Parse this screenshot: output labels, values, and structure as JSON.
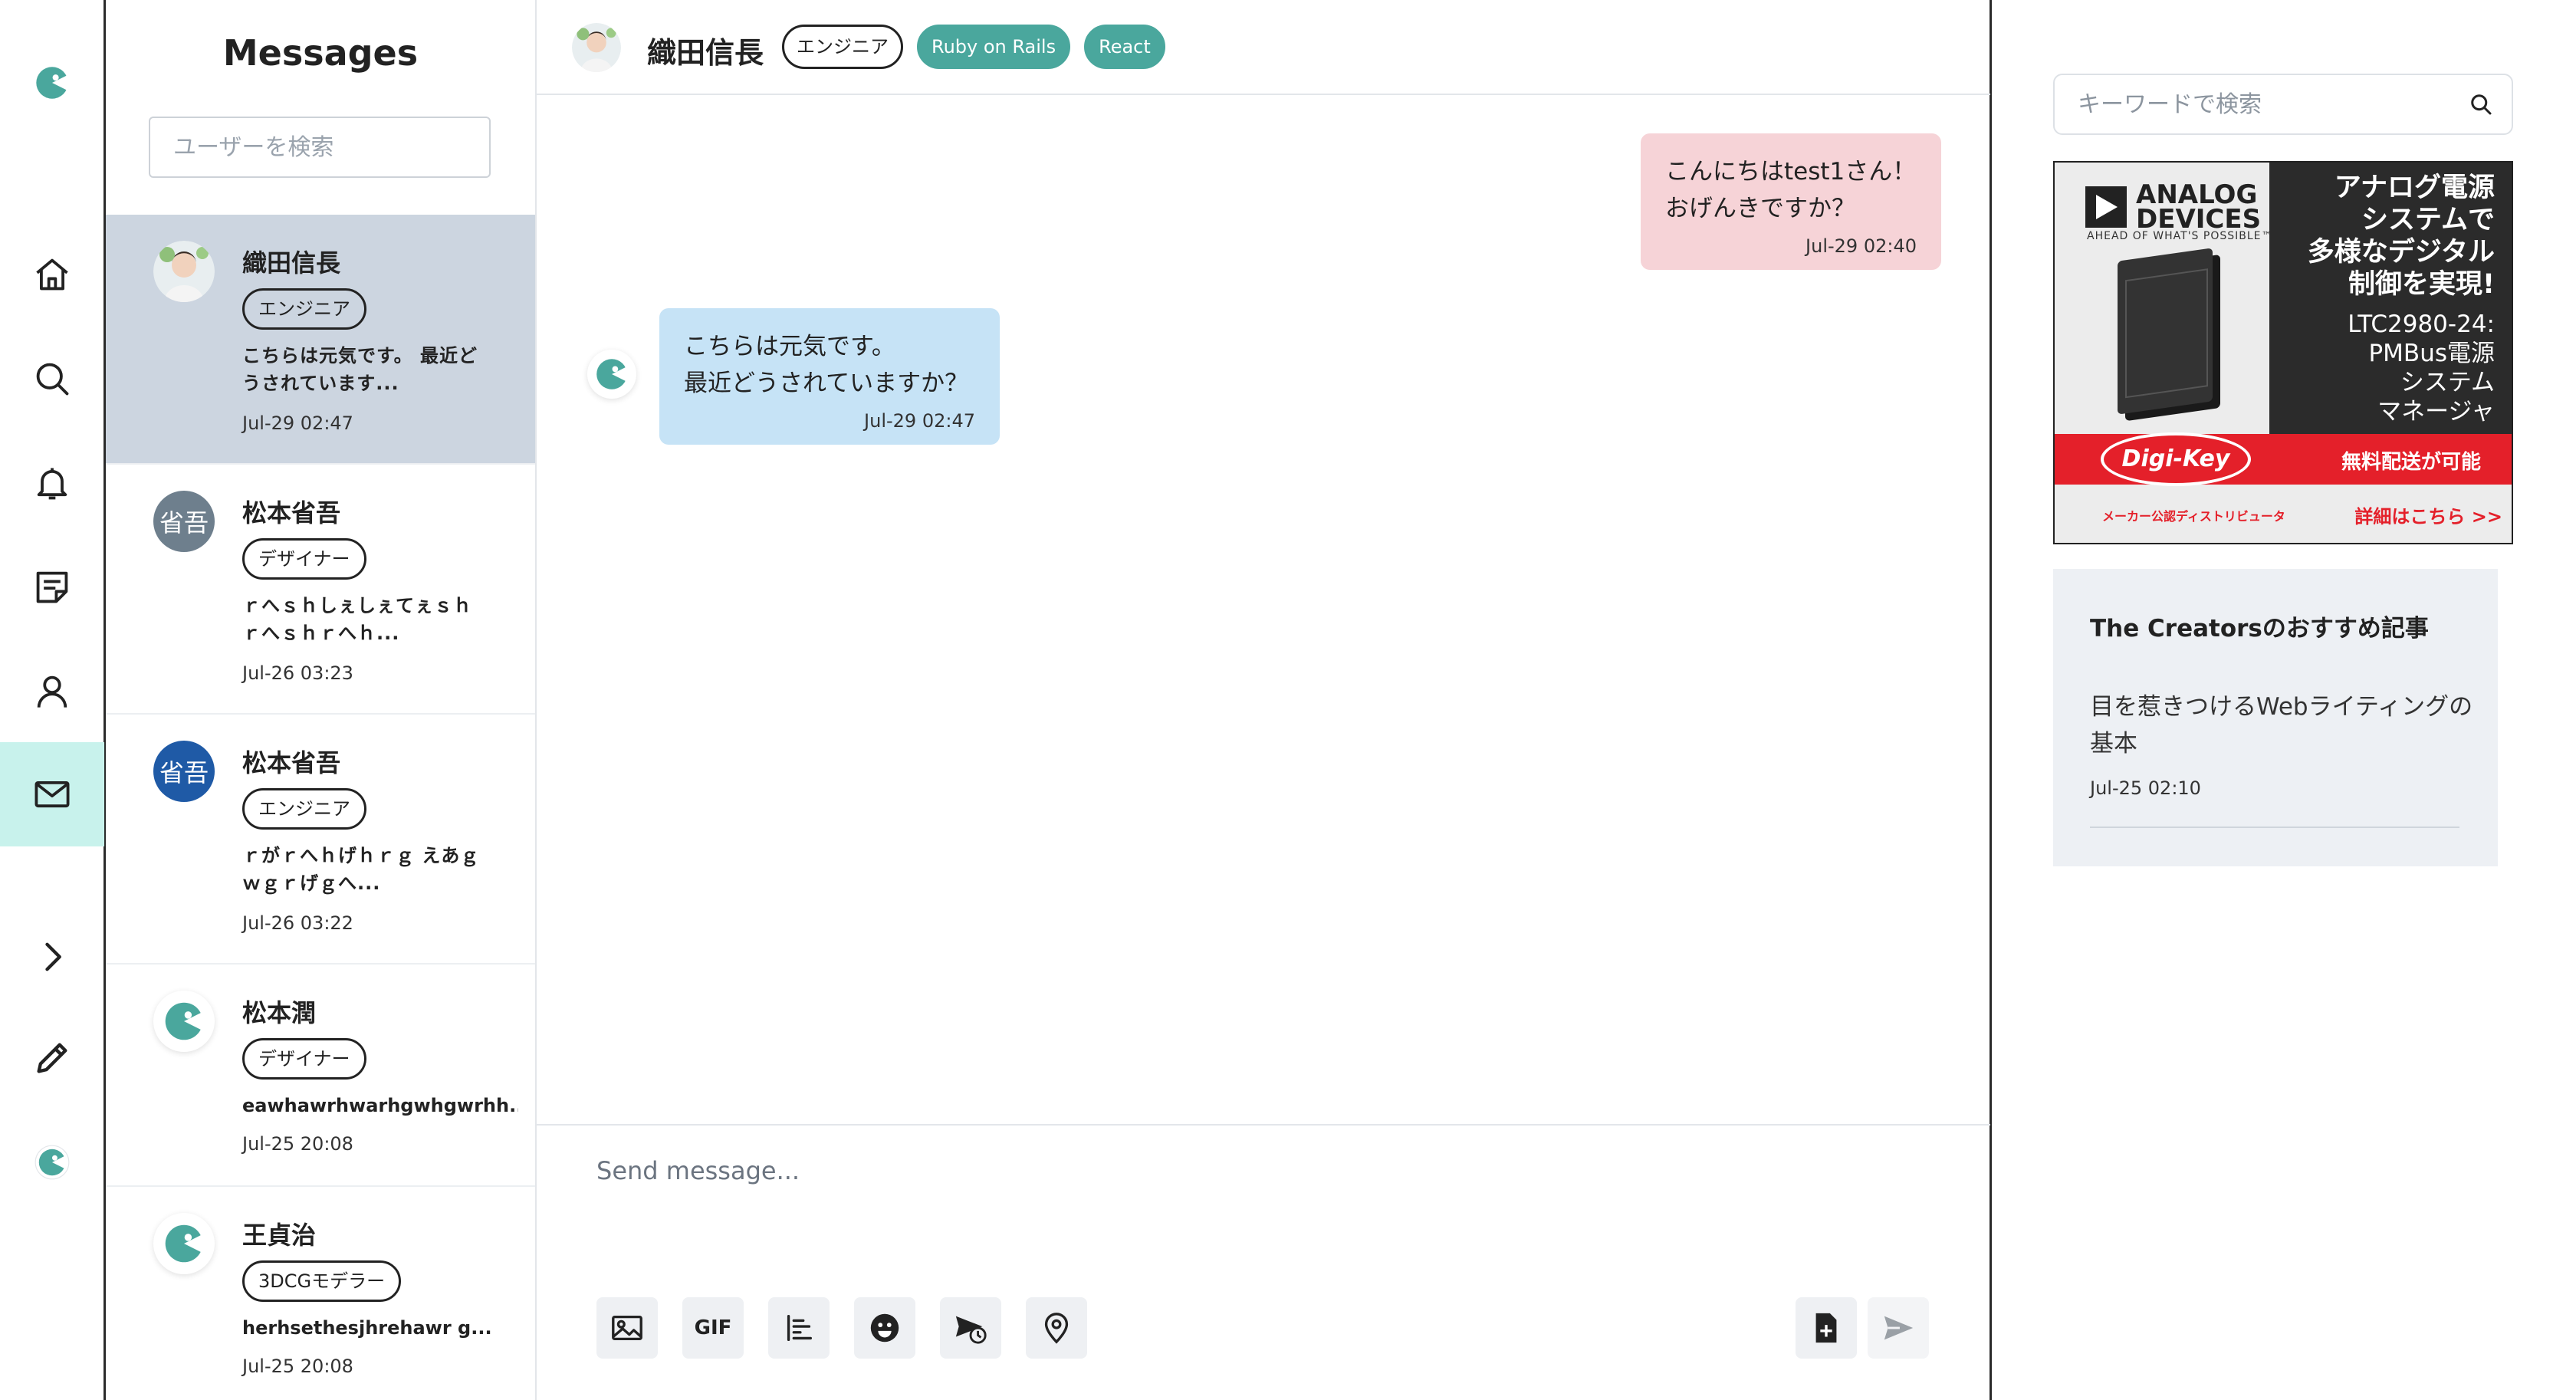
{
  "colors": {
    "accent": "#4aa79d",
    "rail_active": "#c8f2ec",
    "selected_row": "#ccd5e0",
    "outgoing_bubble": "#f6d3d7",
    "incoming_bubble": "#c6e3f6"
  },
  "rail": {
    "icons": [
      "app-logo-icon",
      "home-icon",
      "search-icon",
      "bell-icon",
      "notes-icon",
      "user-icon",
      "mail-icon",
      "chevron-right-icon",
      "pencil-icon",
      "profile-logo-icon"
    ],
    "active": "mail-icon"
  },
  "conversations": {
    "title": "Messages",
    "search_placeholder": "ユーザーを検索",
    "items": [
      {
        "name": "織田信長",
        "role": "エンジニア",
        "preview": "こちらは元気です。 最近どうされています...",
        "time": "Jul-29 02:47",
        "avatar": "photo",
        "selected": true
      },
      {
        "name": "松本省吾",
        "role": "デザイナー",
        "preview": "ｒへｓｈしぇしぇてぇｓｈ ｒへｓｈｒへｈ...",
        "time": "Jul-26 03:23",
        "avatar": "initials",
        "initials": "省吾",
        "avatar_color": "#6e7f8d"
      },
      {
        "name": "松本省吾",
        "role": "エンジニア",
        "preview": "ｒがｒへｈげｈｒｇ えあｇ ｗｇｒげｇへ...",
        "time": "Jul-26 03:22",
        "avatar": "initials",
        "initials": "省吾",
        "avatar_color": "#1f5aa6"
      },
      {
        "name": "松本潤",
        "role": "デザイナー",
        "preview": "eawhawrhwarhgwhgwrhh...",
        "time": "Jul-25 20:08",
        "avatar": "logo"
      },
      {
        "name": "王貞治",
        "role": "3DCGモデラー",
        "preview": "herhsethesjhrehawr g...",
        "time": "Jul-25 20:08",
        "avatar": "logo"
      }
    ]
  },
  "chat": {
    "name": "織田信長",
    "tags": [
      "エンジニア",
      "Ruby on Rails",
      "React"
    ],
    "messages": [
      {
        "direction": "outgoing",
        "text": "こんにちはtest1さん！\nおげんきですか？",
        "time": "Jul-29 02:40"
      },
      {
        "direction": "incoming",
        "text": "こちらは元気です。\n最近どうされていますか？",
        "time": "Jul-29 02:47"
      }
    ],
    "composer": {
      "placeholder": "Send message...",
      "tools": [
        "image-icon",
        "GIF",
        "poll-icon",
        "emoji-icon",
        "schedule-icon",
        "location-icon"
      ],
      "gif_label": "GIF",
      "actions": [
        "file-add-icon",
        "send-icon"
      ]
    }
  },
  "sidebar": {
    "search_placeholder": "キーワードで検索",
    "ad": {
      "brand": "ANALOG\nDEVICES",
      "tagline": "AHEAD OF WHAT'S POSSIBLE™",
      "headline": "アナログ電源\nシステムで\n多様なデジタル\n制御を実現!",
      "product": "LTC2980-24:\nPMBus電源\nシステム\nマネージャ",
      "distributor_logo": "Digi-Key",
      "shipping": "無料配送が可能",
      "distributor_text": "メーカー公認ディストリビュータ",
      "more_link": "詳細はこちら >>"
    },
    "recommend": {
      "title": "The Creatorsのおすすめ記事",
      "articles": [
        {
          "title": "目を惹きつけるWebライティングの基本",
          "time": "Jul-25 02:10"
        }
      ]
    }
  }
}
